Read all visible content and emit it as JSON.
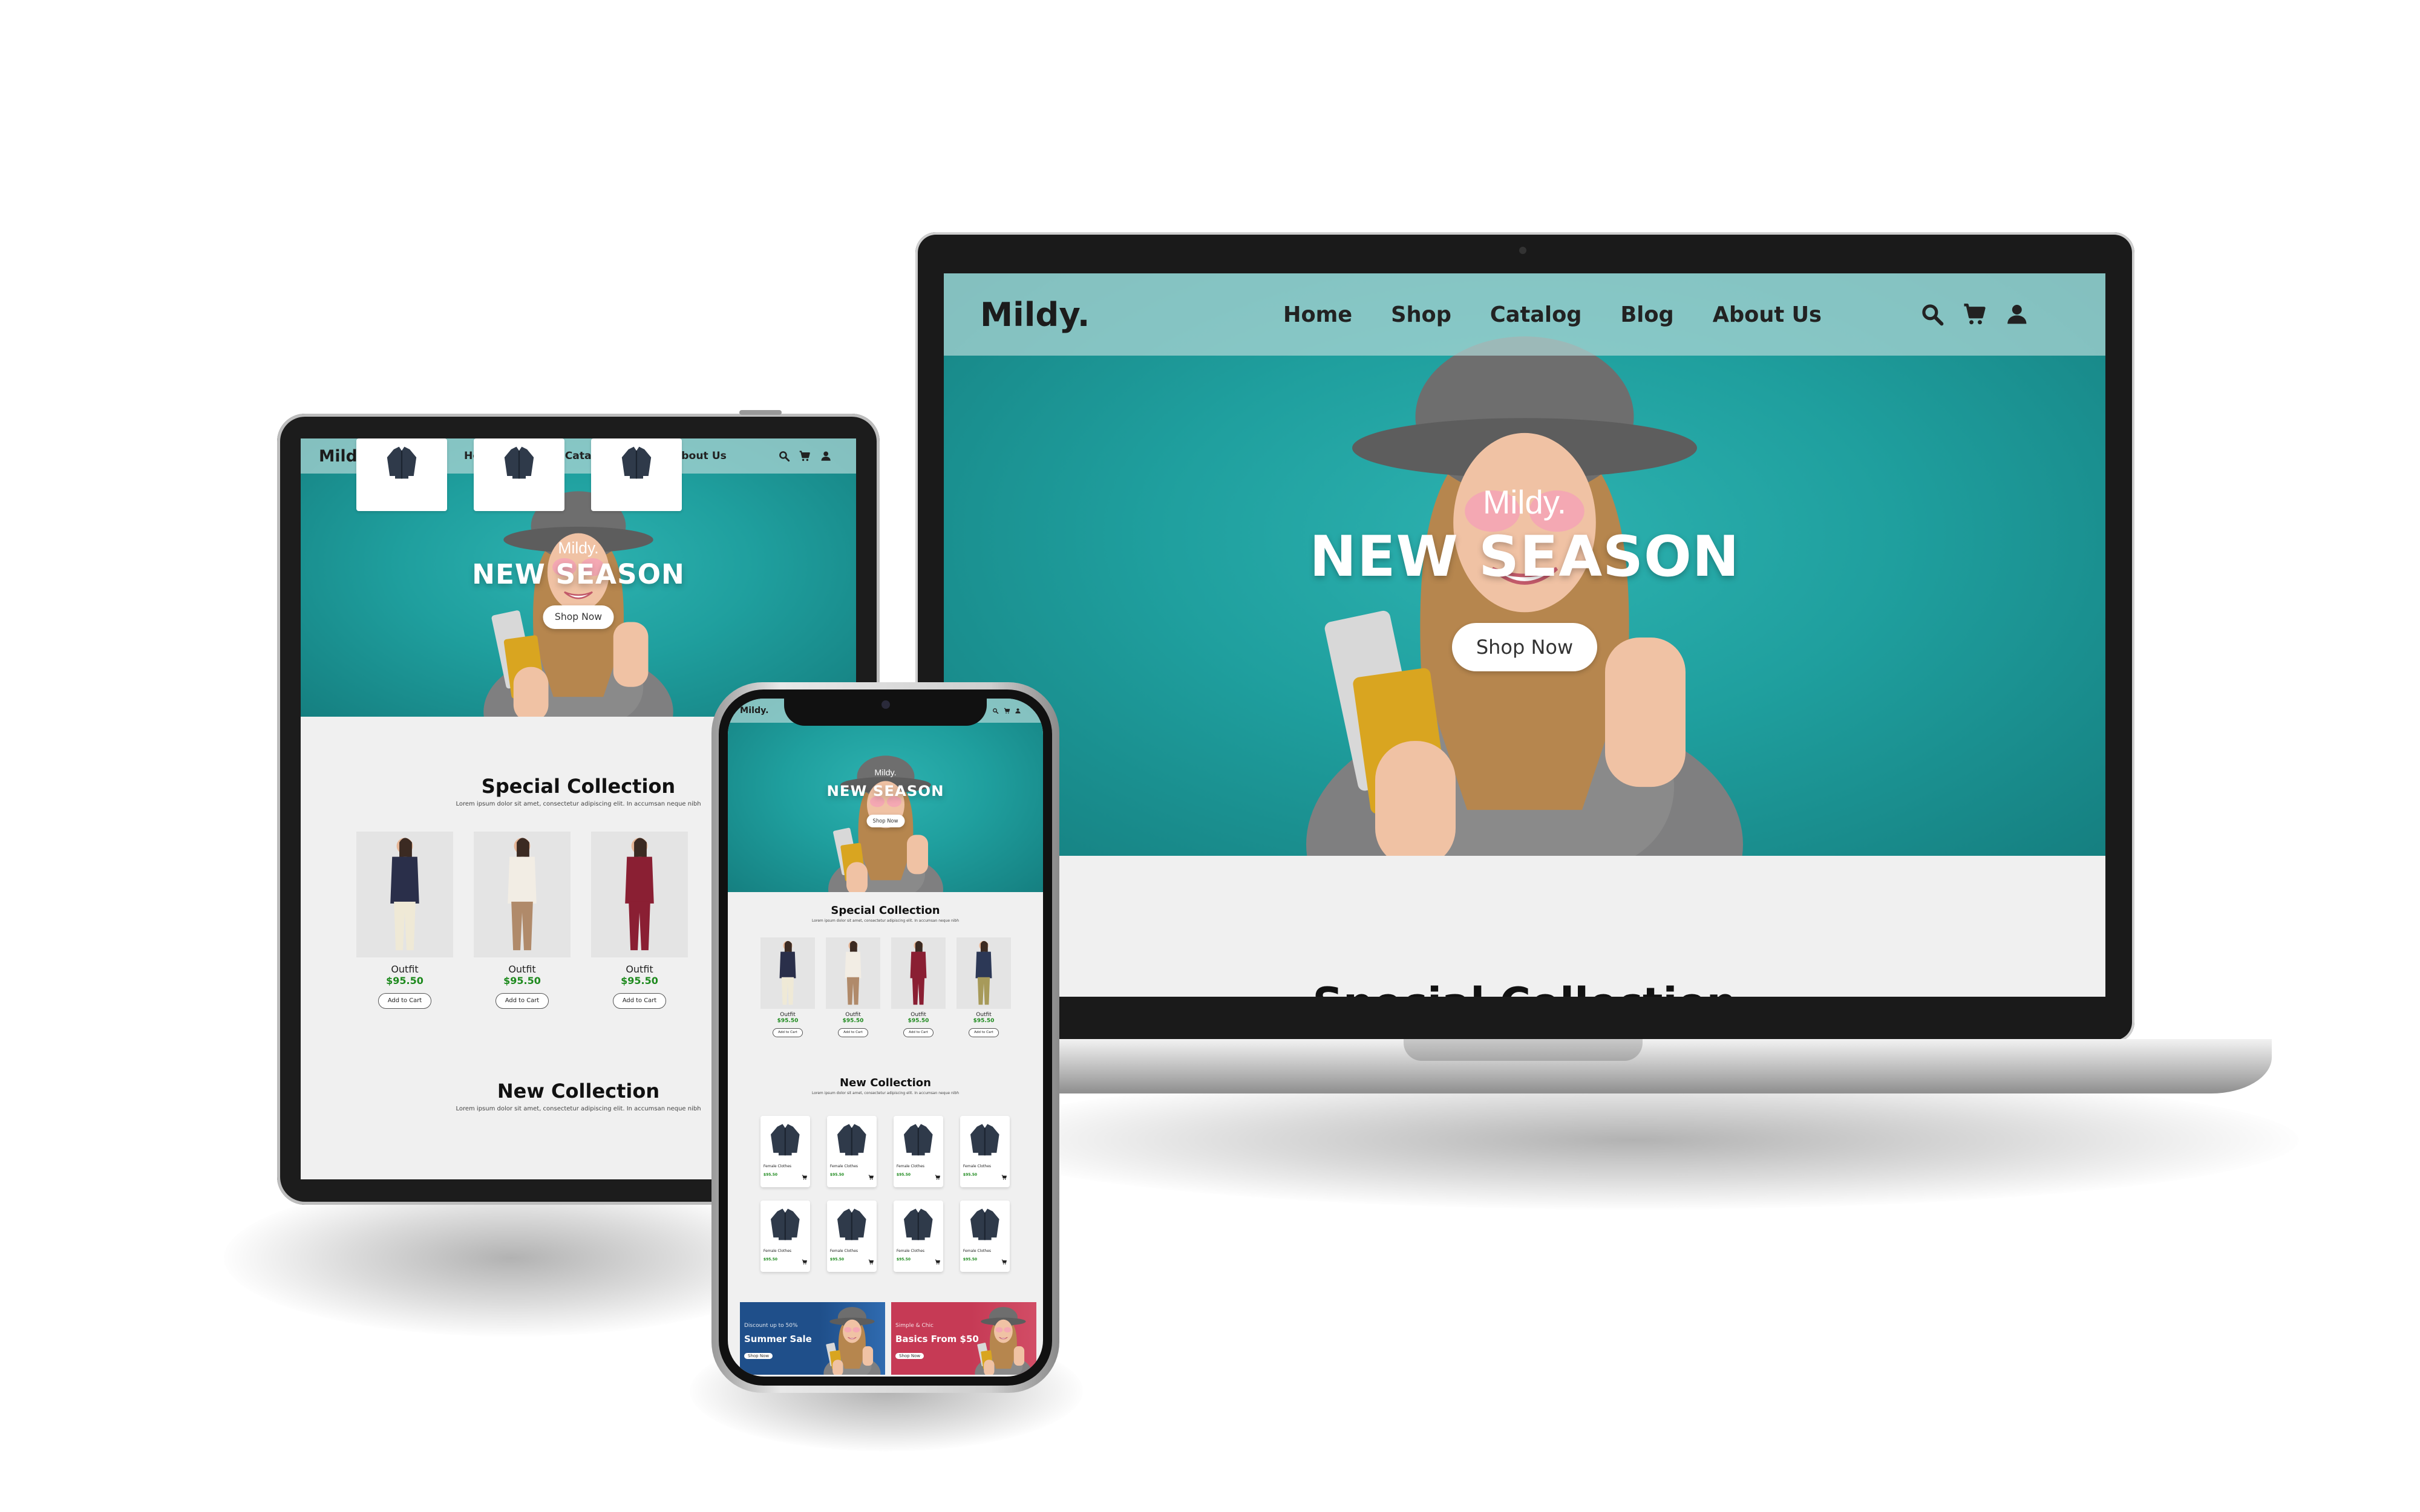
{
  "site": {
    "logo": "Mildy.",
    "nav": [
      "Home",
      "Shop",
      "Catalog",
      "Blog",
      "About Us"
    ],
    "icons": [
      "search-icon",
      "cart-icon",
      "user-icon"
    ],
    "hero": {
      "subtitle": "Mildy.",
      "title": "NEW SEASON",
      "button": "Shop Now"
    },
    "special": {
      "title": "Special Collection",
      "desc": "Lorem ipsum dolor sit amet, consectetur adipiscing elit. In accumsan neque nibh",
      "products": [
        {
          "name": "Outfit",
          "price": "$95.50",
          "button": "Add to Cart"
        },
        {
          "name": "Outfit",
          "price": "$95.50",
          "button": "Add to Cart"
        },
        {
          "name": "Outfit",
          "price": "$95.50",
          "button": "Add to Cart"
        },
        {
          "name": "Outfit",
          "price": "$95.50",
          "button": "Add to Cart"
        }
      ]
    },
    "newc": {
      "title": "New Collection",
      "desc": "Lorem ipsum dolor sit amet, consectetur adipiscing elit. In accumsan neque nibh",
      "item_name": "Female Clothes",
      "item_price": "$95.50"
    },
    "banners": [
      {
        "tag": "Discount up to 50%",
        "title": "Summer Sale",
        "button": "Shop Now"
      },
      {
        "tag": "Simple & Chic",
        "title": "Basics From $50",
        "button": "Shop Now"
      }
    ],
    "laptop_peek": "Special Collection"
  },
  "colors": {
    "teal": "#1fa19f",
    "price_green": "#1e8a1e",
    "banner_blue": "#1f4f8a",
    "banner_red": "#c63a55"
  }
}
